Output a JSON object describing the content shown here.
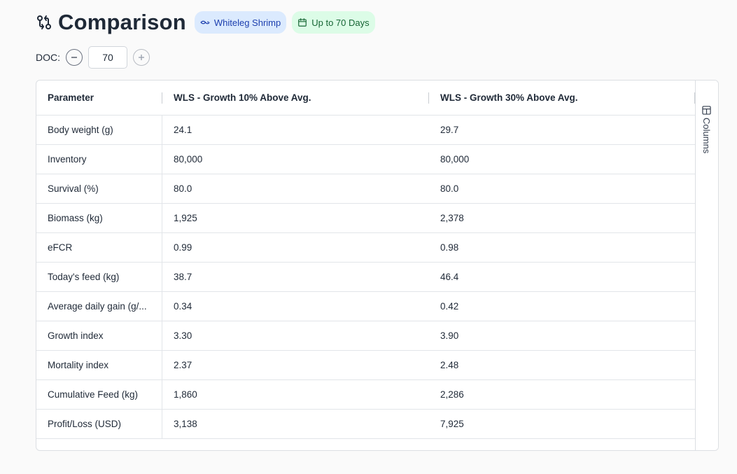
{
  "header": {
    "title": "Comparison",
    "species_chip": "Whiteleg Shrimp",
    "days_chip": "Up to 70 Days"
  },
  "doc": {
    "label": "DOC:",
    "value": "70"
  },
  "table": {
    "columns": [
      "Parameter",
      "WLS - Growth 10% Above Avg.",
      "WLS - Growth 30% Above Avg."
    ],
    "rows": [
      [
        "Body weight (g)",
        "24.1",
        "29.7"
      ],
      [
        "Inventory",
        "80,000",
        "80,000"
      ],
      [
        "Survival (%)",
        "80.0",
        "80.0"
      ],
      [
        "Biomass (kg)",
        "1,925",
        "2,378"
      ],
      [
        "eFCR",
        "0.99",
        "0.98"
      ],
      [
        "Today's feed (kg)",
        "38.7",
        "46.4"
      ],
      [
        "Average daily gain (g/...",
        "0.34",
        "0.42"
      ],
      [
        "Growth index",
        "3.30",
        "3.90"
      ],
      [
        "Mortality index",
        "2.37",
        "2.48"
      ],
      [
        "Cumulative Feed (kg)",
        "1,860",
        "2,286"
      ],
      [
        "Profit/Loss (USD)",
        "3,138",
        "7,925"
      ]
    ]
  },
  "side_panel": {
    "columns_label": "Columns"
  },
  "colors": {
    "species_chip_bg": "#dbeafe",
    "days_chip_bg": "#dcfce7"
  }
}
